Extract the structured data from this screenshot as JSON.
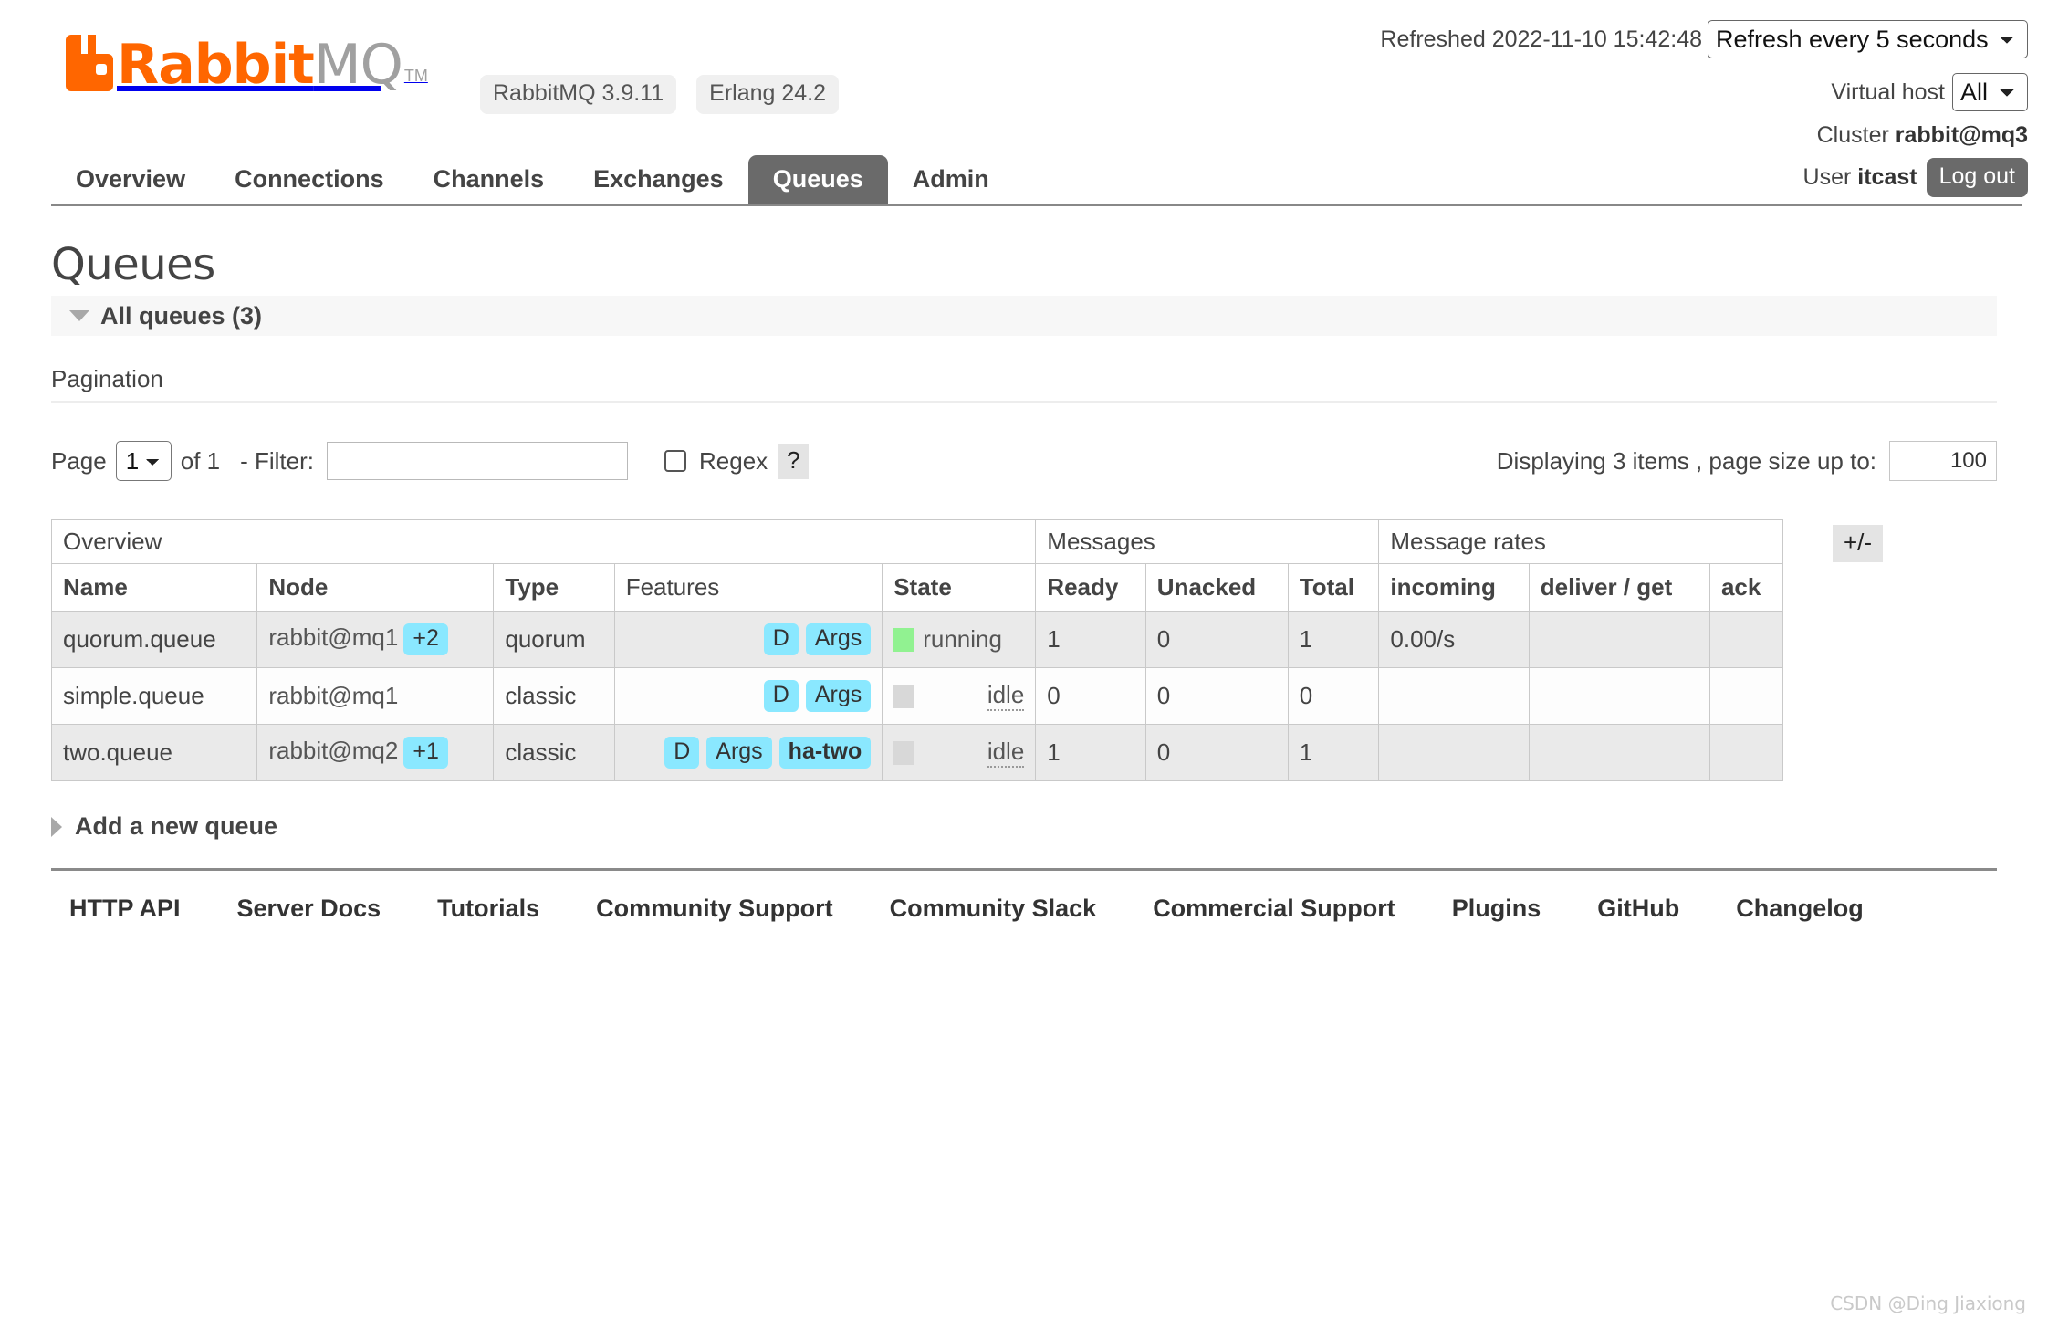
{
  "brand": {
    "name_rabbit": "Rabbit",
    "name_mq": "MQ",
    "tm": "TM",
    "logo_icon": "rabbitmq-logo-icon",
    "accent_color": "#ff6600",
    "versions": [
      {
        "label": "RabbitMQ 3.9.11"
      },
      {
        "label": "Erlang 24.2"
      }
    ]
  },
  "status": {
    "refreshed_text": "Refreshed 2022-11-10 15:42:48",
    "refresh_interval_selected": "Refresh every 5 seconds",
    "refresh_interval_options": [
      "Refresh every 5 seconds"
    ],
    "vhost_label": "Virtual host",
    "vhost_selected": "All",
    "vhost_options": [
      "All"
    ],
    "cluster_label": "Cluster",
    "cluster_name": "rabbit@mq3",
    "user_label": "User",
    "user_name": "itcast",
    "logout_label": "Log out"
  },
  "nav": {
    "tabs": [
      {
        "label": "Overview",
        "active": false
      },
      {
        "label": "Connections",
        "active": false
      },
      {
        "label": "Channels",
        "active": false
      },
      {
        "label": "Exchanges",
        "active": false
      },
      {
        "label": "Queues",
        "active": true
      },
      {
        "label": "Admin",
        "active": false
      }
    ]
  },
  "page": {
    "title": "Queues",
    "all_queues_label": "All queues (3)",
    "pagination_label": "Pagination",
    "add_queue_label": "Add a new queue"
  },
  "paging": {
    "page_label": "Page",
    "page_selected": "1",
    "page_options": [
      "1"
    ],
    "of_label": "of 1",
    "filter_label": "- Filter:",
    "filter_value": "",
    "filter_placeholder": "",
    "regex_label": "Regex",
    "regex_checked": false,
    "help_label": "?",
    "displaying_text": "Displaying 3 items , page size up to:",
    "page_size_value": "100"
  },
  "table": {
    "group_headers": [
      {
        "label": "Overview",
        "span": 5
      },
      {
        "label": "Messages",
        "span": 3
      },
      {
        "label": "Message rates",
        "span": 3
      }
    ],
    "plus_minus_label": "+/-",
    "columns": [
      {
        "label": "Name",
        "bold": true,
        "align": "left"
      },
      {
        "label": "Node",
        "bold": true,
        "align": "left"
      },
      {
        "label": "Type",
        "bold": true,
        "align": "left"
      },
      {
        "label": "Features",
        "bold": false,
        "align": "left"
      },
      {
        "label": "State",
        "bold": true,
        "align": "left"
      },
      {
        "label": "Ready",
        "bold": true,
        "align": "left"
      },
      {
        "label": "Unacked",
        "bold": true,
        "align": "left"
      },
      {
        "label": "Total",
        "bold": true,
        "align": "left"
      },
      {
        "label": "incoming",
        "bold": true,
        "align": "left"
      },
      {
        "label": "deliver / get",
        "bold": true,
        "align": "left"
      },
      {
        "label": "ack",
        "bold": true,
        "align": "left"
      }
    ],
    "rows": [
      {
        "name": "quorum.queue",
        "node": "rabbit@mq1",
        "node_badge": "+2",
        "type": "quorum",
        "features": [
          {
            "text": "D",
            "style": "blue"
          },
          {
            "text": "Args",
            "style": "blue"
          }
        ],
        "state": "running",
        "state_kind": "running",
        "ready": "1",
        "unacked": "0",
        "total": "1",
        "incoming": "0.00/s",
        "deliver_get": "",
        "ack": ""
      },
      {
        "name": "simple.queue",
        "node": "rabbit@mq1",
        "node_badge": "",
        "type": "classic",
        "features": [
          {
            "text": "D",
            "style": "blue"
          },
          {
            "text": "Args",
            "style": "blue"
          }
        ],
        "state": "idle",
        "state_kind": "idle",
        "ready": "0",
        "unacked": "0",
        "total": "0",
        "incoming": "",
        "deliver_get": "",
        "ack": ""
      },
      {
        "name": "two.queue",
        "node": "rabbit@mq2",
        "node_badge": "+1",
        "type": "classic",
        "features": [
          {
            "text": "D",
            "style": "blue"
          },
          {
            "text": "Args",
            "style": "blue"
          },
          {
            "text": "ha-two",
            "style": "blue-bold"
          }
        ],
        "state": "idle",
        "state_kind": "idle",
        "ready": "1",
        "unacked": "0",
        "total": "1",
        "incoming": "",
        "deliver_get": "",
        "ack": ""
      }
    ]
  },
  "footer": {
    "links": [
      "HTTP API",
      "Server Docs",
      "Tutorials",
      "Community Support",
      "Community Slack",
      "Commercial Support",
      "Plugins",
      "GitHub",
      "Changelog"
    ]
  },
  "watermark": "CSDN @Ding Jiaxiong"
}
